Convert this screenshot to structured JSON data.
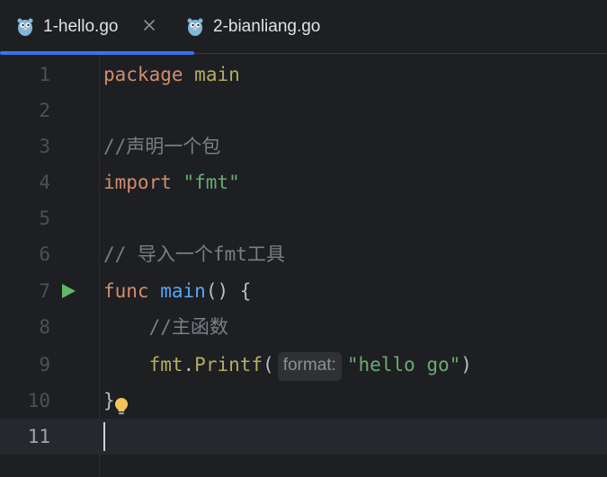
{
  "tabs": [
    {
      "label": "1-hello.go",
      "active": true,
      "icon": "gopher-icon"
    },
    {
      "label": "2-bianliang.go",
      "active": false,
      "icon": "gopher-icon"
    }
  ],
  "colors": {
    "accent": "#3574f0",
    "keyword": "#cf8e6d",
    "string": "#6aab73",
    "comment": "#7a7e85",
    "function": "#56a8f5",
    "run": "#5fb865",
    "bulb": "#f2c55c"
  },
  "editor": {
    "current_line": 11,
    "lines": [
      {
        "num": "1",
        "parts": {
          "k1": "package",
          "s1": " ",
          "p1": "main"
        }
      },
      {
        "num": "2"
      },
      {
        "num": "3",
        "parts": {
          "c1": "//声明一个包"
        }
      },
      {
        "num": "4",
        "parts": {
          "k1": "import",
          "s1": " ",
          "str1": "\"fmt\""
        }
      },
      {
        "num": "5"
      },
      {
        "num": "6",
        "parts": {
          "c1": "// 导入一个fmt工具"
        }
      },
      {
        "num": "7",
        "parts": {
          "k1": "func",
          "s1": " ",
          "f1": "main",
          "t1": "() {"
        },
        "gutter_icon": "run-icon"
      },
      {
        "num": "8",
        "parts": {
          "ind": "    ",
          "c1": "//主函数"
        }
      },
      {
        "num": "9",
        "parts": {
          "ind": "    ",
          "p1": "fmt",
          "t1": ".",
          "f2": "Printf",
          "t2": "(",
          "hint": "format:",
          "str1": "\"hello go\"",
          "t3": ")"
        }
      },
      {
        "num": "10",
        "parts": {
          "t1": "}"
        },
        "inline_icon": "lightbulb-icon"
      },
      {
        "num": "11"
      }
    ]
  }
}
